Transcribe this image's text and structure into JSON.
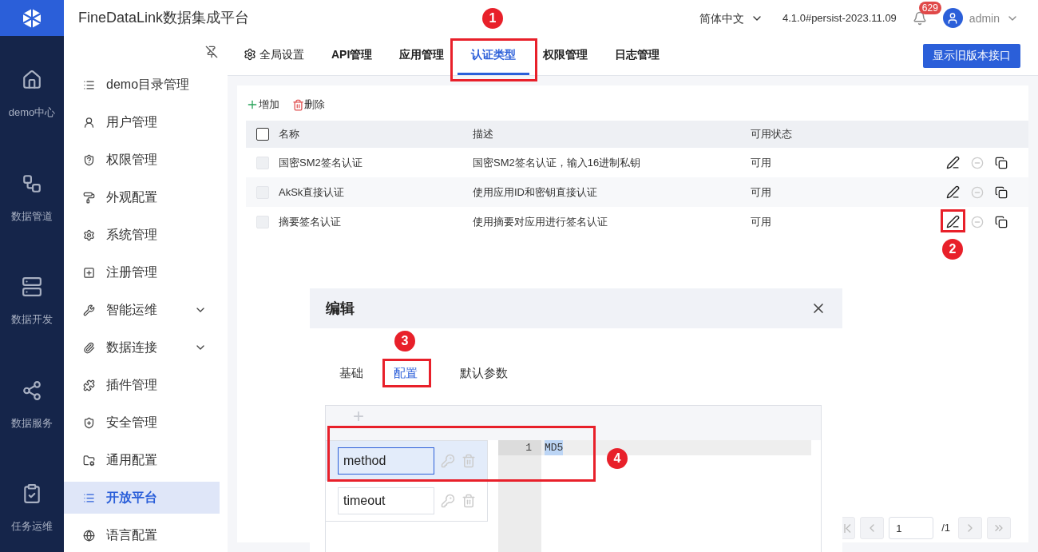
{
  "header": {
    "title": "FineDataLink数据集成平台",
    "language": "简体中文",
    "version": "4.1.0#persist-2023.11.09",
    "notifications": "629",
    "user": "admin"
  },
  "rail": [
    {
      "label": "demo中心"
    },
    {
      "label": "数据管道"
    },
    {
      "label": "数据开发"
    },
    {
      "label": "数据服务"
    },
    {
      "label": "任务运维"
    }
  ],
  "sidebar": {
    "items": [
      {
        "label": "demo目录管理",
        "selected": false
      },
      {
        "label": "用户管理",
        "selected": false
      },
      {
        "label": "权限管理",
        "selected": false
      },
      {
        "label": "外观配置",
        "selected": false
      },
      {
        "label": "系统管理",
        "selected": false
      },
      {
        "label": "注册管理",
        "selected": false
      },
      {
        "label": "智能运维",
        "selected": false,
        "expanded": false
      },
      {
        "label": "数据连接",
        "selected": false,
        "expanded": false
      },
      {
        "label": "插件管理",
        "selected": false
      },
      {
        "label": "安全管理",
        "selected": false
      },
      {
        "label": "通用配置",
        "selected": false
      },
      {
        "label": "开放平台",
        "selected": true
      },
      {
        "label": "语言配置",
        "selected": false
      }
    ]
  },
  "tabs": [
    {
      "label": "全局设置",
      "selected": false,
      "kind": "icon"
    },
    {
      "label": "API管理",
      "selected": false,
      "kind": "plain"
    },
    {
      "label": "应用管理",
      "selected": false,
      "kind": "plain"
    },
    {
      "label": "认证类型",
      "selected": true,
      "kind": "plain"
    },
    {
      "label": "权限管理",
      "selected": false,
      "kind": "plain"
    },
    {
      "label": "日志管理",
      "selected": false,
      "kind": "plain"
    }
  ],
  "legacy_button": "显示旧版本接口",
  "toolbar": {
    "add": "增加",
    "delete": "删除"
  },
  "table": {
    "header_checked": false,
    "columns": [
      "名称",
      "描述",
      "可用状态"
    ],
    "rows": [
      {
        "cells": [
          "国密SM2签名认证",
          "国密SM2签名认证，输入16进制私钥",
          "可用"
        ],
        "checked": false,
        "disabled": true
      },
      {
        "cells": [
          "AkSk直接认证",
          "使用应用ID和密钥直接认证",
          "可用"
        ],
        "checked": false,
        "disabled": true
      },
      {
        "cells": [
          "摘要签名认证",
          "使用摘要对应用进行签名认证",
          "可用"
        ],
        "checked": false,
        "disabled": true
      }
    ]
  },
  "pagination": {
    "page": "1",
    "total": "/1"
  },
  "dialog": {
    "title": "编辑",
    "tabs": [
      {
        "label": "基础",
        "selected": false
      },
      {
        "label": "配置",
        "selected": true
      },
      {
        "label": "默认参数",
        "selected": false
      }
    ],
    "add_icon": "+",
    "params": [
      {
        "name": "method",
        "selected": true
      },
      {
        "name": "timeout",
        "selected": false
      }
    ],
    "code_lines": [
      {
        "number": "1",
        "text": "MD5"
      }
    ]
  },
  "annotations": [
    {
      "label": "1"
    },
    {
      "label": "2"
    },
    {
      "label": "3"
    },
    {
      "label": "4"
    }
  ]
}
